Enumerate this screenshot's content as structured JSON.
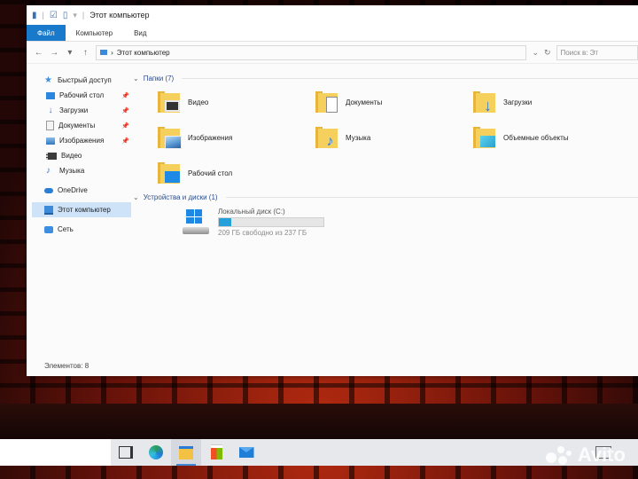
{
  "window": {
    "title": "Этот компьютер",
    "ribbon_tabs": [
      "Файл",
      "Компьютер",
      "Вид"
    ],
    "address": "Этот компьютер",
    "search_placeholder": "Поиск в: Эт"
  },
  "sidebar": {
    "items": [
      {
        "label": "Быстрый доступ",
        "icon": "star-icon",
        "kind": "top"
      },
      {
        "label": "Рабочий стол",
        "icon": "desktop-icon",
        "pinned": true
      },
      {
        "label": "Загрузки",
        "icon": "download-icon",
        "pinned": true
      },
      {
        "label": "Документы",
        "icon": "document-icon",
        "pinned": true
      },
      {
        "label": "Изображения",
        "icon": "image-icon",
        "pinned": true
      },
      {
        "label": "Видео",
        "icon": "video-icon"
      },
      {
        "label": "Музыка",
        "icon": "music-icon"
      },
      {
        "label": "OneDrive",
        "icon": "cloud-icon",
        "kind": "group"
      },
      {
        "label": "Этот компьютер",
        "icon": "computer-icon",
        "kind": "group",
        "selected": true
      },
      {
        "label": "Сеть",
        "icon": "network-icon",
        "kind": "group"
      }
    ]
  },
  "main": {
    "folders_header": "Папки (7)",
    "folders": [
      {
        "label": "Видео",
        "badge": "video"
      },
      {
        "label": "Документы",
        "badge": "doc"
      },
      {
        "label": "Загрузки",
        "badge": "down"
      },
      {
        "label": "Изображения",
        "badge": "img"
      },
      {
        "label": "Музыка",
        "badge": "music"
      },
      {
        "label": "Объемные объекты",
        "badge": "3d"
      },
      {
        "label": "Рабочий стол",
        "badge": "desktop"
      }
    ],
    "devices_header": "Устройства и диски (1)",
    "drive": {
      "name": "Локальный диск (C:)",
      "space": "209 ГБ свободно из 237 ГБ",
      "used_fraction": 0.12
    }
  },
  "status": {
    "items": "Элементов: 8"
  },
  "taskbar": {
    "apps": [
      "task-view-icon",
      "edge-icon",
      "file-explorer-icon",
      "store-icon",
      "mail-icon"
    ],
    "active": "file-explorer-icon"
  },
  "watermark": {
    "text": "Avito"
  }
}
